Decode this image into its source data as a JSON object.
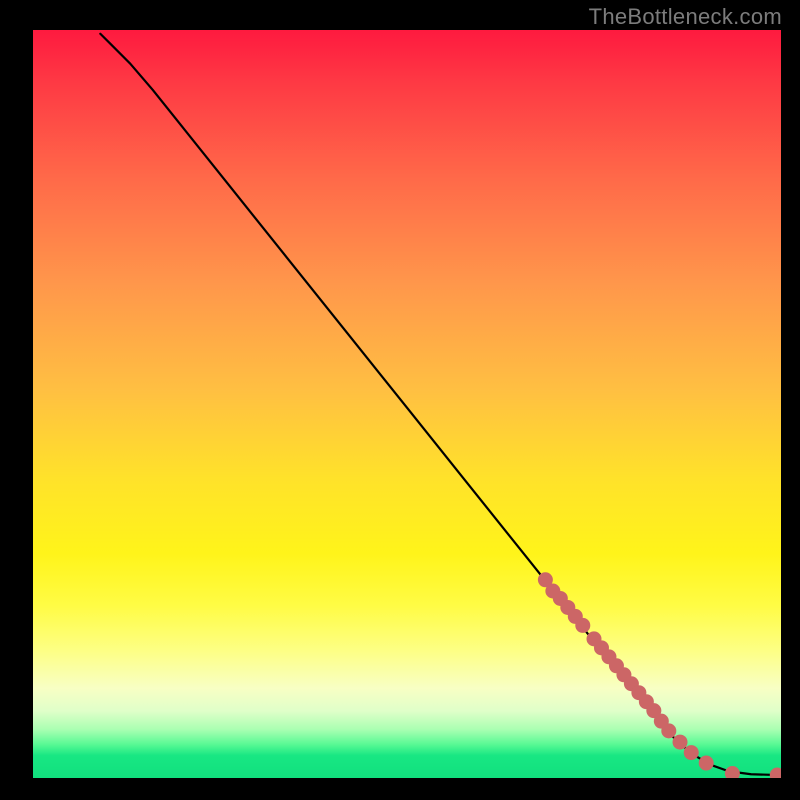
{
  "watermark": "TheBottleneck.com",
  "chart_data": {
    "type": "line",
    "title": "",
    "xlabel": "",
    "ylabel": "",
    "xlim": [
      0,
      100
    ],
    "ylim": [
      0,
      100
    ],
    "curve": {
      "name": "bottleneck-curve",
      "x": [
        9.0,
        10.5,
        13.0,
        16.0,
        20.0,
        26.0,
        34.0,
        42.0,
        50.0,
        58.0,
        66.0,
        74.0,
        78.0,
        82.0,
        85.0,
        88.0,
        90.5,
        93.0,
        96.0,
        99.5
      ],
      "y": [
        99.5,
        98.0,
        95.5,
        92.0,
        87.0,
        79.5,
        69.5,
        59.5,
        49.5,
        39.5,
        29.5,
        19.5,
        14.5,
        9.5,
        6.0,
        3.3,
        1.8,
        0.9,
        0.5,
        0.4
      ]
    },
    "points": {
      "name": "data-points",
      "color": "#cc6666",
      "x": [
        68.5,
        69.5,
        70.5,
        71.5,
        72.5,
        73.5,
        75.0,
        76.0,
        77.0,
        78.0,
        79.0,
        80.0,
        81.0,
        82.0,
        83.0,
        84.0,
        85.0,
        86.5,
        88.0,
        90.0,
        93.5,
        99.5
      ],
      "y": [
        26.5,
        25.0,
        24.0,
        22.8,
        21.6,
        20.4,
        18.6,
        17.4,
        16.2,
        15.0,
        13.8,
        12.6,
        11.4,
        10.2,
        9.0,
        7.6,
        6.3,
        4.8,
        3.4,
        2.0,
        0.6,
        0.4
      ]
    }
  }
}
